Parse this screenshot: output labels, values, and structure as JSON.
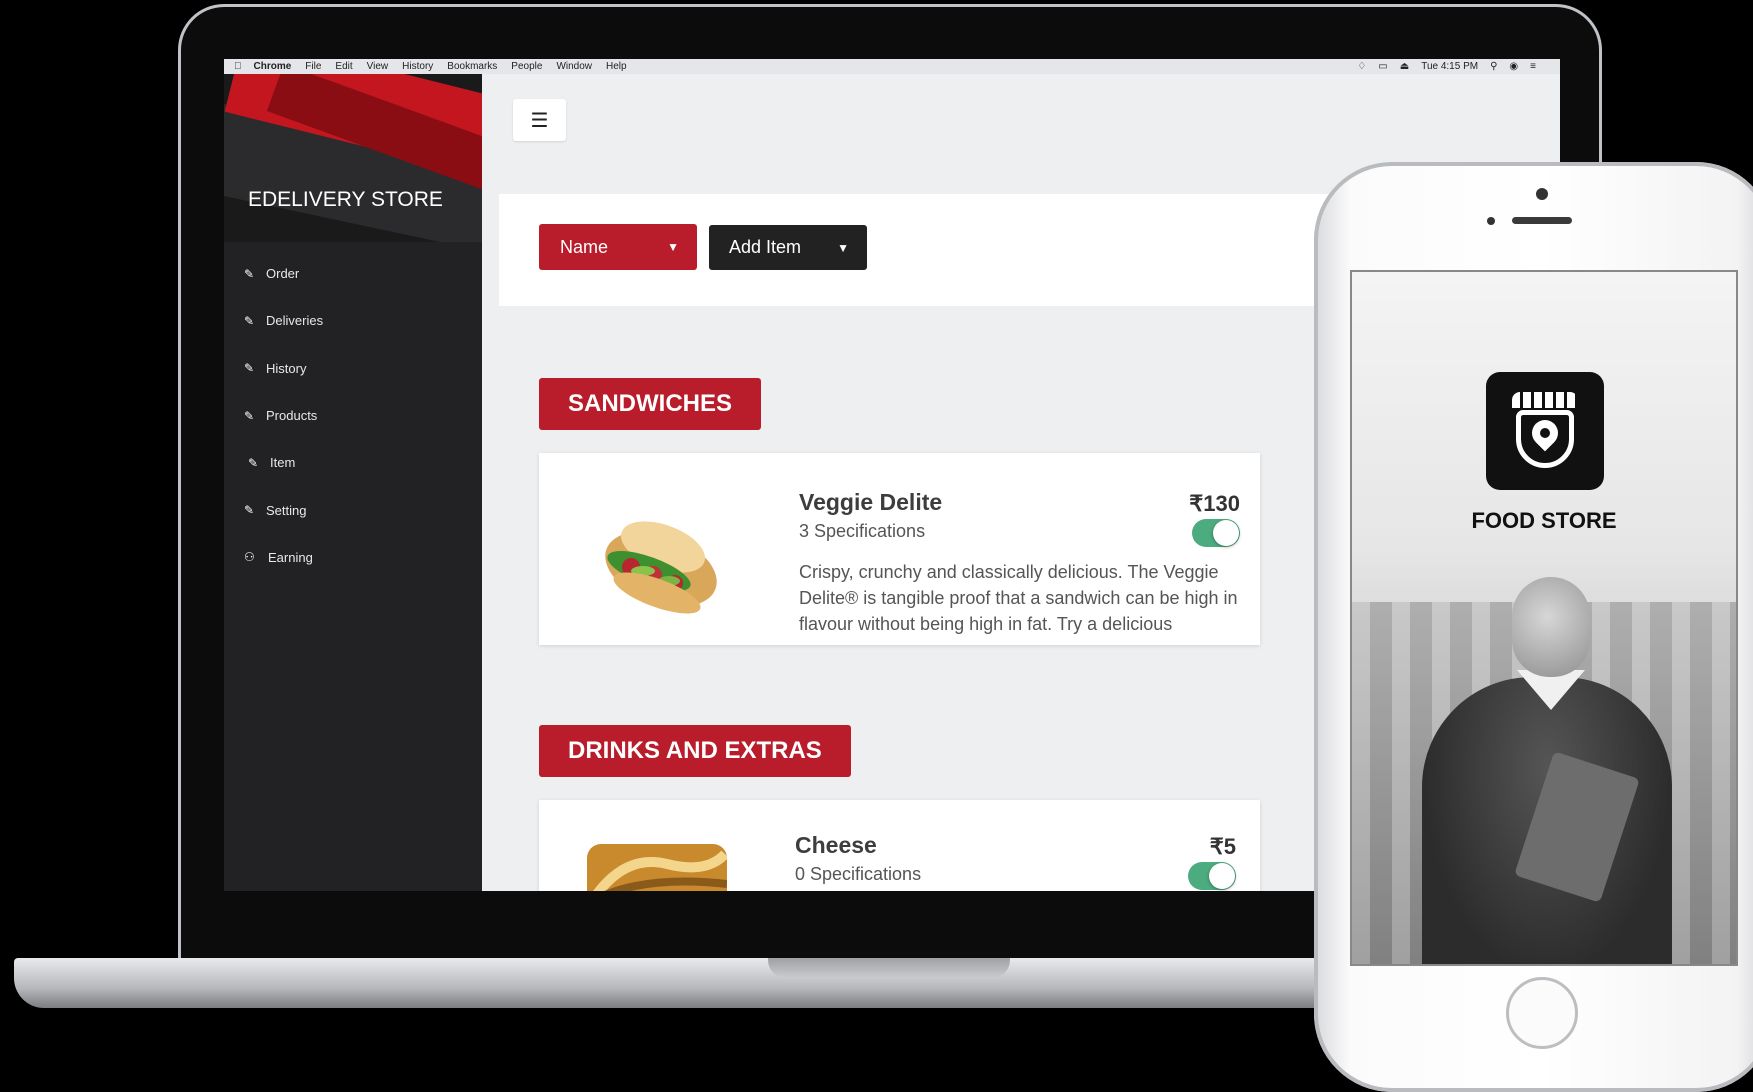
{
  "menubar": {
    "app": "Chrome",
    "items": [
      "File",
      "Edit",
      "View",
      "History",
      "Bookmarks",
      "People",
      "Window",
      "Help"
    ],
    "clock": "Tue 4:15 PM"
  },
  "sidebar": {
    "title": "EDELIVERY STORE",
    "items": [
      {
        "label": "Order",
        "icon": "pencil-icon"
      },
      {
        "label": "Deliveries",
        "icon": "pencil-icon"
      },
      {
        "label": "History",
        "icon": "pencil-icon"
      },
      {
        "label": "Products",
        "icon": "pencil-icon"
      },
      {
        "label": "Item",
        "icon": "pencil-icon"
      },
      {
        "label": "Setting",
        "icon": "pencil-icon"
      },
      {
        "label": "Earning",
        "icon": "users-icon"
      }
    ]
  },
  "toolbar": {
    "sort_label": "Name",
    "add_label": "Add Item"
  },
  "categories": [
    {
      "name": "SANDWICHES",
      "items": [
        {
          "name": "Veggie Delite",
          "specs": "3 Specifications",
          "price": "₹130",
          "enabled": true,
          "description": "Crispy, crunchy and classically delicious. The Veggie Delite® is tangible proof that a sandwich can be high in flavour without being high in fat. Try a delicious"
        }
      ]
    },
    {
      "name": "DRINKS AND EXTRAS",
      "items": [
        {
          "name": "Cheese",
          "specs": "0 Specifications",
          "price": "₹5",
          "enabled": true
        }
      ]
    }
  ],
  "phone": {
    "app_title": "FOOD STORE"
  },
  "colors": {
    "accent": "#b91c2a",
    "sidebar": "#222224",
    "toggle_on": "#4cab7f"
  }
}
